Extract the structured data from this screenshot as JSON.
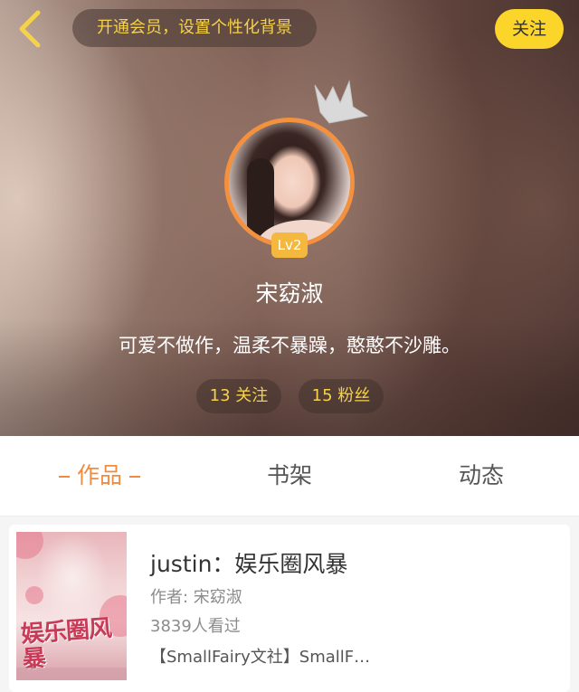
{
  "header": {
    "vip_promo": "开通会员，设置个性化背景",
    "follow_button": "关注"
  },
  "profile": {
    "level": "Lv2",
    "nickname": "宋窈淑",
    "signature": "可爱不做作，温柔不暴躁，憨憨不沙雕。",
    "stats": {
      "following": "13 关注",
      "fans": "15 粉丝"
    }
  },
  "tabs": {
    "works": "作品",
    "bookshelf": "书架",
    "dynamic": "动态"
  },
  "works": [
    {
      "cover_text": "娱乐圈风暴",
      "title": "justin：娱乐圈风暴",
      "author": "作者: 宋窈淑",
      "views": "3839人看过",
      "description": "【SmallFairy文社】SmallF…"
    }
  ],
  "colors": {
    "accent": "#f08b43",
    "yellow": "#fbd52a",
    "badge": "#f3b83d"
  }
}
